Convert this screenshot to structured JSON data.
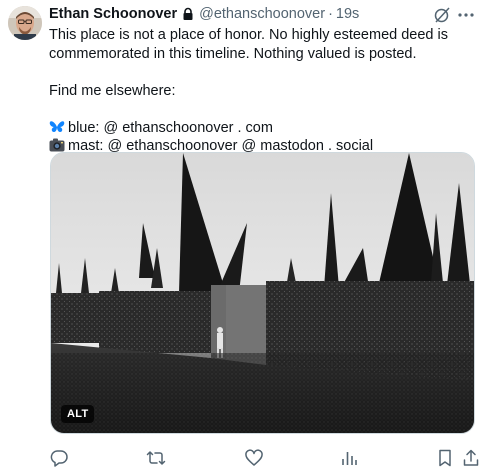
{
  "author": {
    "display_name": "Ethan Schoonover",
    "handle": "@ethanschoonover",
    "separator": "·",
    "time": "19s",
    "protected": true
  },
  "post": {
    "line1": "This place is not a place of honor. No highly esteemed deed is",
    "line2": "commemorated in this timeline. Nothing valued is posted.",
    "line3": "Find me elsewhere:",
    "blue_text": "blue: @ ethanschoonover . com",
    "mast_text": "mast: @ ethanschoonover @ mastodon . social"
  },
  "media": {
    "alt_label": "ALT"
  },
  "icons": {
    "lock": "lock-icon",
    "grok": "grok-icon",
    "more": "more-icon",
    "butterfly": "butterfly-emoji",
    "camera": "camera-emoji",
    "reply": "reply-icon",
    "repost": "repost-icon",
    "like": "heart-icon",
    "views": "views-icon",
    "bookmark": "bookmark-icon",
    "share": "share-icon"
  },
  "colors": {
    "text": "#0f1419",
    "secondary": "#536471",
    "bluesky": "#1185fe"
  }
}
